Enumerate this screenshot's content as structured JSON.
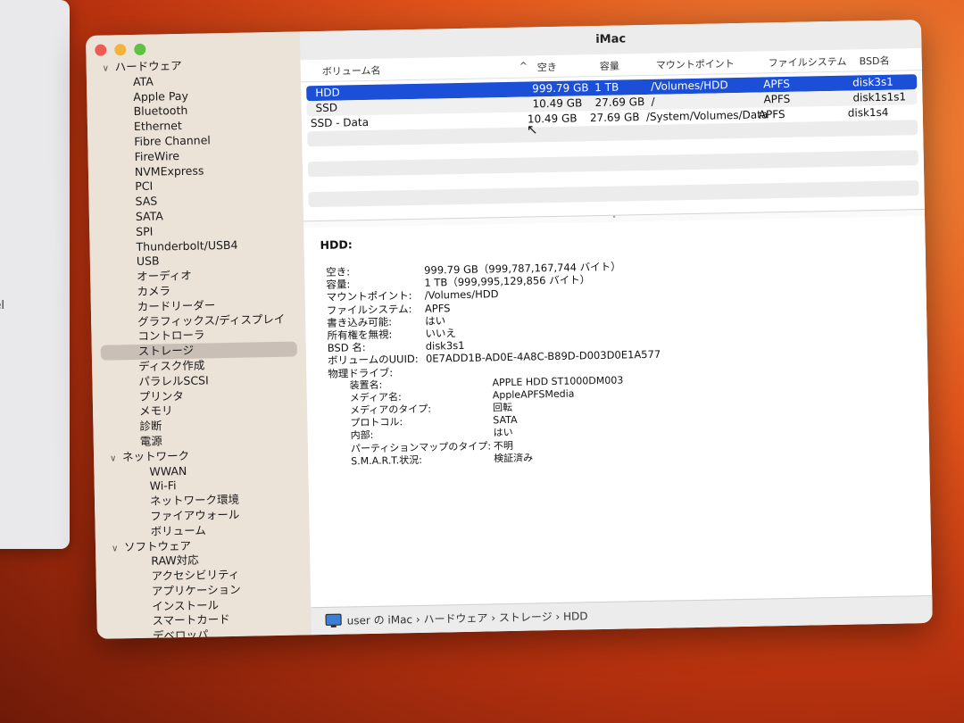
{
  "background_window": {
    "partial_text": "ntel"
  },
  "window": {
    "title": "iMac"
  },
  "sidebar": {
    "groups": [
      {
        "label": "ハードウェア",
        "items": [
          "ATA",
          "Apple Pay",
          "Bluetooth",
          "Ethernet",
          "Fibre Channel",
          "FireWire",
          "NVMExpress",
          "PCI",
          "SAS",
          "SATA",
          "SPI",
          "Thunderbolt/USB4",
          "USB",
          "オーディオ",
          "カメラ",
          "カードリーダー",
          "グラフィックス/ディスプレイ",
          "コントローラ",
          "ストレージ",
          "ディスク作成",
          "パラレルSCSI",
          "プリンタ",
          "メモリ",
          "診断",
          "電源"
        ]
      },
      {
        "label": "ネットワーク",
        "items": [
          "WWAN",
          "Wi-Fi",
          "ネットワーク環境",
          "ファイアウォール",
          "ボリューム"
        ]
      },
      {
        "label": "ソフトウェア",
        "items": [
          "RAW対応",
          "アクセシビリティ",
          "アプリケーション",
          "インストール",
          "スマートカード",
          "デベロッパ"
        ]
      }
    ],
    "selected_item": "ストレージ"
  },
  "table": {
    "columns": [
      "ボリューム名",
      "空き",
      "容量",
      "マウントポイント",
      "ファイルシステム",
      "BSD名"
    ],
    "sort_indicator": "^",
    "rows": [
      {
        "name": "HDD",
        "free": "999.79 GB",
        "capacity": "1 TB",
        "mount": "/Volumes/HDD",
        "fs": "APFS",
        "bsd": "disk3s1",
        "selected": true
      },
      {
        "name": "SSD",
        "free": "10.49 GB",
        "capacity": "27.69 GB",
        "mount": "/",
        "fs": "APFS",
        "bsd": "disk1s1s1"
      },
      {
        "name": "SSD - Data",
        "free": "10.49 GB",
        "capacity": "27.69 GB",
        "mount": "/System/Volumes/Data",
        "fs": "APFS",
        "bsd": "disk1s4"
      }
    ]
  },
  "detail": {
    "heading": "HDD:",
    "fields": [
      {
        "k": "空き:",
        "v": "999.79 GB（999,787,167,744 バイト）"
      },
      {
        "k": "容量:",
        "v": "1 TB（999,995,129,856 バイト）"
      },
      {
        "k": "マウントポイント:",
        "v": "/Volumes/HDD"
      },
      {
        "k": "ファイルシステム:",
        "v": "APFS"
      },
      {
        "k": "書き込み可能:",
        "v": "はい"
      },
      {
        "k": "所有権を無視:",
        "v": "いいえ"
      },
      {
        "k": "BSD 名:",
        "v": "disk3s1"
      },
      {
        "k": "ボリュームのUUID:",
        "v": "0E7ADD1B-AD0E-4A8C-B89D-D003D0E1A577"
      },
      {
        "k": "物理ドライブ:",
        "v": ""
      }
    ],
    "physical": [
      {
        "k": "装置名:",
        "v": "APPLE HDD ST1000DM003"
      },
      {
        "k": "メディア名:",
        "v": "AppleAPFSMedia"
      },
      {
        "k": "メディアのタイプ:",
        "v": "回転"
      },
      {
        "k": "プロトコル:",
        "v": "SATA"
      },
      {
        "k": "内部:",
        "v": "はい"
      },
      {
        "k": "パーティションマップのタイプ:",
        "v": "不明"
      },
      {
        "k": "S.M.A.R.T.状況:",
        "v": "検証済み"
      }
    ]
  },
  "statusbar": {
    "path": "user の iMac › ハードウェア › ストレージ › HDD"
  }
}
